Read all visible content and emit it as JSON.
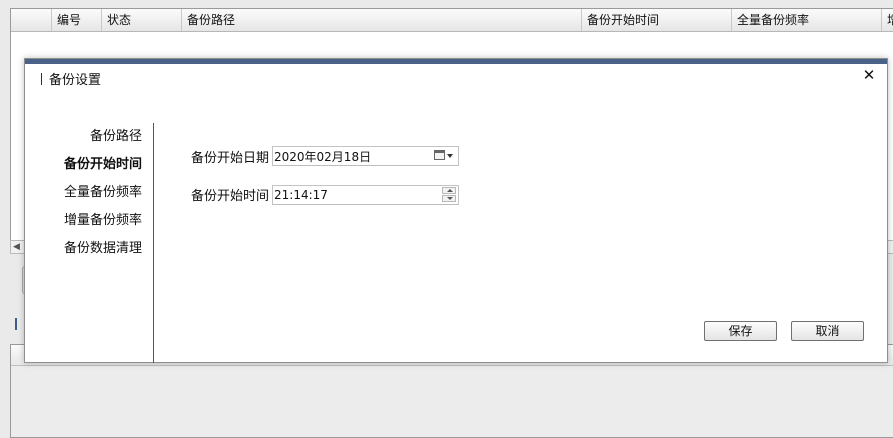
{
  "background_table": {
    "columns": [
      {
        "label": ""
      },
      {
        "label": "编号"
      },
      {
        "label": "状态"
      },
      {
        "label": "备份路径"
      },
      {
        "label": "备份开始时间"
      },
      {
        "label": "全量备份频率"
      },
      {
        "label": "增"
      }
    ]
  },
  "dialog": {
    "title": "备份设置",
    "close_glyph": "✕",
    "nav": [
      {
        "label": "备份路径",
        "active": false
      },
      {
        "label": "备份开始时间",
        "active": true
      },
      {
        "label": "全量备份频率",
        "active": false
      },
      {
        "label": "增量备份频率",
        "active": false
      },
      {
        "label": "备份数据清理",
        "active": false
      }
    ],
    "form": {
      "start_date_label": "备份开始日期",
      "start_date_value": "2020年02月18日",
      "start_time_label": "备份开始时间",
      "start_time_value": "21:14:17"
    },
    "buttons": {
      "save": "保存",
      "cancel": "取消"
    }
  },
  "colors": {
    "dialog_accent": "#4a6287"
  }
}
